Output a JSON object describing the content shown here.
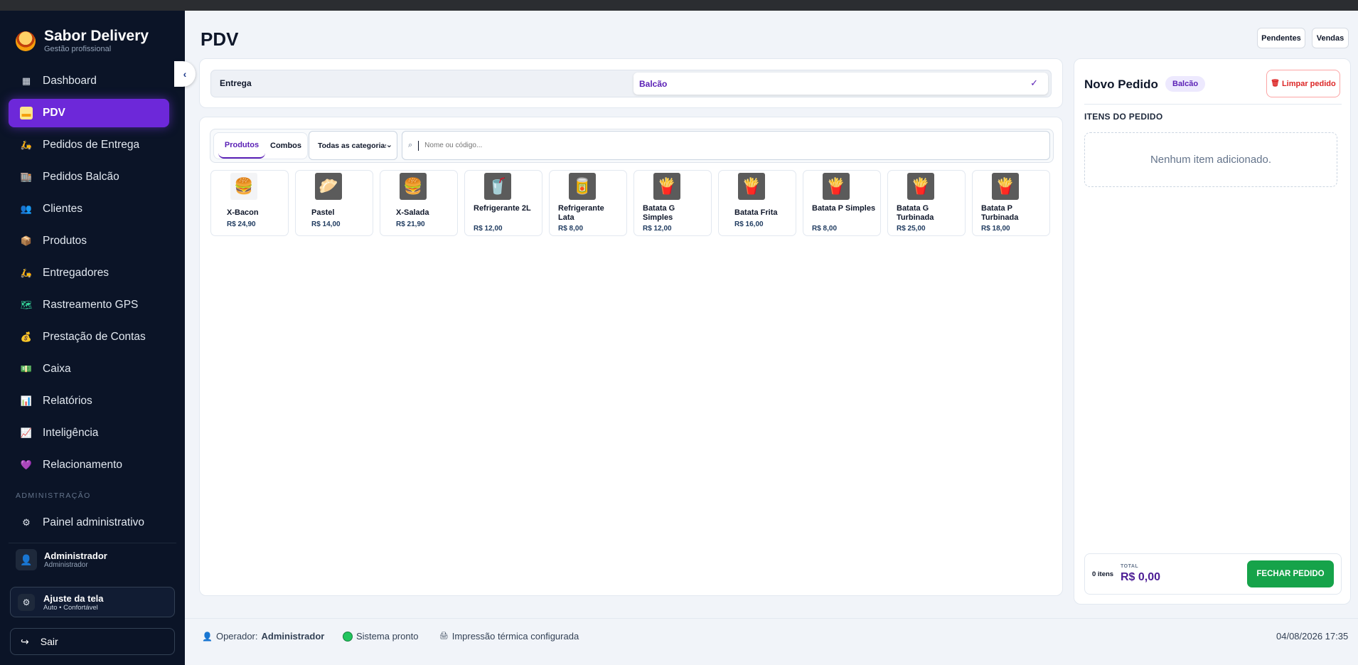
{
  "brand": {
    "title": "Sabor Delivery",
    "subtitle": "Gestão profissional"
  },
  "nav": [
    {
      "label": "Dashboard",
      "icon": "grid-icon",
      "glyph": "▦",
      "color": "#e2e8f0",
      "bg": "transparent"
    },
    {
      "label": "PDV",
      "icon": "card-icon",
      "glyph": "▬",
      "color": "#f59e0b",
      "bg": "#fde68a",
      "active": true
    },
    {
      "label": "Pedidos de Entrega",
      "icon": "scooter-icon",
      "glyph": "🛵",
      "color": "#60a5fa",
      "bg": "transparent"
    },
    {
      "label": "Pedidos Balcão",
      "icon": "store-icon",
      "glyph": "🏬",
      "color": "#a78bfa",
      "bg": "transparent"
    },
    {
      "label": "Clientes",
      "icon": "users-icon",
      "glyph": "👥",
      "color": "#fbbf24",
      "bg": "transparent"
    },
    {
      "label": "Produtos",
      "icon": "box-icon",
      "glyph": "📦",
      "color": "#d97706",
      "bg": "transparent"
    },
    {
      "label": "Entregadores",
      "icon": "courier-icon",
      "glyph": "🛵",
      "color": "#60a5fa",
      "bg": "transparent"
    },
    {
      "label": "Rastreamento GPS",
      "icon": "map-icon",
      "glyph": "🗺",
      "color": "#34d399",
      "bg": "transparent"
    },
    {
      "label": "Prestação de Contas",
      "icon": "money-bag-icon",
      "glyph": "💰",
      "color": "#fbbf24",
      "bg": "transparent"
    },
    {
      "label": "Caixa",
      "icon": "cash-icon",
      "glyph": "💵",
      "color": "#86efac",
      "bg": "transparent"
    },
    {
      "label": "Relatórios",
      "icon": "bar-chart-icon",
      "glyph": "📊",
      "color": "#f87171",
      "bg": "transparent"
    },
    {
      "label": "Inteligência",
      "icon": "trend-chart-icon",
      "glyph": "📈",
      "color": "#f87171",
      "bg": "transparent"
    },
    {
      "label": "Relacionamento",
      "icon": "heart-icon",
      "glyph": "💜",
      "color": "#a78bfa",
      "bg": "transparent"
    }
  ],
  "admin": {
    "section_label": "ADMINISTRAÇÃO",
    "panel_label": "Painel administrativo",
    "panel_glyph": "⚙"
  },
  "user": {
    "name": "Administrador",
    "role": "Administrador",
    "glyph": "👤"
  },
  "screen_adjust": {
    "title": "Ajuste da tela",
    "subtitle": "Auto • Confortável",
    "glyph": "⚙"
  },
  "logout": {
    "label": "Sair",
    "glyph": "↪"
  },
  "collapse_glyph": "‹",
  "page": {
    "title": "PDV",
    "pending_label": "Pendentes",
    "sales_label": "Vendas"
  },
  "order_type": {
    "delivery_label": "Entrega",
    "counter_label": "Balcão",
    "check_glyph": "✓"
  },
  "filters": {
    "tab_products": "Produtos",
    "tab_combos": "Combos",
    "category_selected": "Todas as categorias",
    "search_placeholder": "Nome ou código..."
  },
  "products": [
    {
      "name": "X-Bacon",
      "price": "R$ 24,90",
      "icon": "burger-icon",
      "glyph": "🍔",
      "light": true
    },
    {
      "name": "Pastel",
      "price": "R$ 14,00",
      "icon": "pastry-icon",
      "glyph": "🥟"
    },
    {
      "name": "X-Salada",
      "price": "R$ 21,90",
      "icon": "burger-icon",
      "glyph": "🍔"
    },
    {
      "name": "Refrigerante 2L",
      "price": "R$ 12,00",
      "icon": "soda-bottle-icon",
      "glyph": "🥤"
    },
    {
      "name": "Refrigerante Lata",
      "price": "R$ 8,00",
      "icon": "soda-can-icon",
      "glyph": "🥫"
    },
    {
      "name": "Batata G Simples",
      "price": "R$ 12,00",
      "icon": "fries-icon",
      "glyph": "🍟"
    },
    {
      "name": "Batata Frita",
      "price": "R$ 16,00",
      "icon": "fries-icon",
      "glyph": "🍟"
    },
    {
      "name": "Batata P Simples",
      "price": "R$ 8,00",
      "icon": "fries-icon",
      "glyph": "🍟"
    },
    {
      "name": "Batata G Turbinada",
      "price": "R$ 25,00",
      "icon": "fries-icon",
      "glyph": "🍟"
    },
    {
      "name": "Batata P Turbinada",
      "price": "R$ 18,00",
      "icon": "fries-icon",
      "glyph": "🍟"
    }
  ],
  "order": {
    "title": "Novo Pedido",
    "type_badge": "Balcão",
    "clear_label": "Limpar pedido",
    "clear_glyph": "🗑",
    "items_label": "ITENS DO PEDIDO",
    "empty_text": "Nenhum item adicionado.",
    "items_count": "0 itens",
    "total_label": "TOTAL",
    "total_value": "R$ 0,00",
    "close_label": "FECHAR PEDIDO"
  },
  "status": {
    "operator_prefix": "Operador:",
    "operator_name": "Administrador",
    "operator_glyph": "👤",
    "system": "Sistema pronto",
    "printer": "Impressão térmica configurada",
    "printer_glyph": "🖨",
    "datetime": "04/08/2026 17:35"
  },
  "colors": {
    "accent": "#6d28d9",
    "sidebar": "#0b1427",
    "success": "#16a34a",
    "danger": "#dc2626"
  }
}
